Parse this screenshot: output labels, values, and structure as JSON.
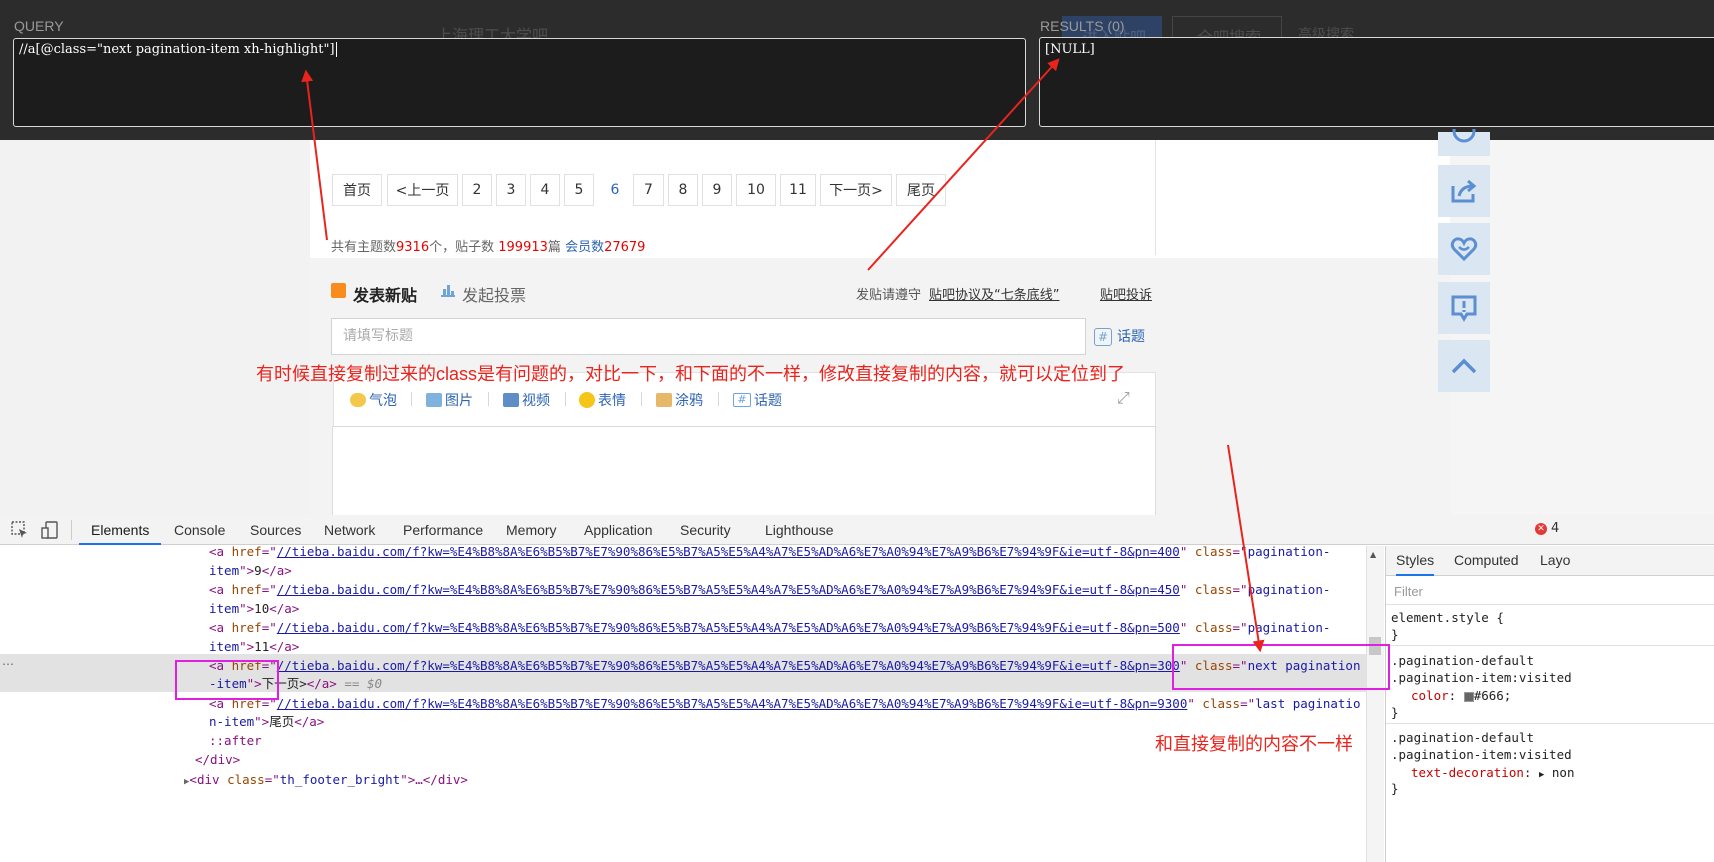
{
  "xpath_helper": {
    "query_label": "QUERY",
    "query_value": "//a[@class=\"next pagination-item xh-highlight\"]",
    "results_label": "RESULTS (0)",
    "results_value": "[NULL]",
    "bg_search_text": "上海理工大学吧",
    "bg_btn_enter": "进入贴吧",
    "bg_btn_search": "全吧搜索",
    "bg_adv_search": "高级搜索"
  },
  "pagination": {
    "first": "首页",
    "prev": "<上一页",
    "pages": [
      "2",
      "3",
      "4",
      "5",
      "6",
      "7",
      "8",
      "9",
      "10",
      "11"
    ],
    "current": "6",
    "next": "下一页>",
    "last": "尾页"
  },
  "stats": {
    "topics_label": "共有主题数",
    "topics": "9316",
    "topics_unit": "个，贴子数",
    "posts": "199913",
    "posts_unit": "篇",
    "members_label": "会员数",
    "members": "27679"
  },
  "post_editor": {
    "title": "发表新贴",
    "poll": "发起投票",
    "rules_prefix": "发贴请遵守",
    "rules_link": "贴吧协议及“七条底线”",
    "report": "贴吧投诉",
    "title_placeholder": "请填写标题",
    "topic_button": "话题",
    "toolbar": [
      "气泡",
      "图片",
      "视频",
      "表情",
      "涂鸦",
      "话题"
    ]
  },
  "annotations": {
    "main": "有时候直接复制过来的class是有问题的，对比一下，和下面的不一样，修改直接复制的内容，就可以定位到了",
    "diff": "和直接复制的内容不一样"
  },
  "devtools": {
    "tabs": [
      "Elements",
      "Console",
      "Sources",
      "Network",
      "Performance",
      "Memory",
      "Application",
      "Security",
      "Lighthouse"
    ],
    "active_tab": "Elements",
    "error_count": "4",
    "styles_tabs": [
      "Styles",
      "Computed",
      "Layo"
    ],
    "filter_placeholder": "Filter",
    "href_prefix": "//tieba.baidu.com/f?kw=%E4%B8%8A%E6%B5%B7%E7%90%86%E5%B7%A5%E5%A4%A7%E5%AD%A6%E7%A0%94%E7%A9%B6%E7%94%9F&ie=utf-8&pn=",
    "dom_rows": [
      {
        "pn": "400",
        "cls": "pagination-",
        "cls2": "item",
        "text": "9"
      },
      {
        "pn": "450",
        "cls": "pagination-",
        "cls2": "item",
        "text": "10"
      },
      {
        "pn": "500",
        "cls": "pagination-",
        "cls2": "item",
        "text": "11"
      },
      {
        "pn": "300",
        "cls": "next pagination",
        "cls2": "-item",
        "text": "下一页>"
      },
      {
        "pn": "9300",
        "cls": "last paginatio",
        "cls2": "n-item",
        "text": "尾页"
      }
    ],
    "selected_suffix": "== $0",
    "after_pseudo": "::after",
    "close_div": "</div>",
    "footer_div_class": "th_footer_bright",
    "styles": {
      "element_style": "element.style {",
      "rule1_sel_a": ".pagination-default",
      "rule1_sel_b": ".pagination-item:visited",
      "rule1_prop": "color",
      "rule1_val": "#666;",
      "rule2_sel_a": ".pagination-default",
      "rule2_sel_b": ".pagination-item:visited",
      "rule2_prop": "text-decoration",
      "rule2_val": "non"
    }
  }
}
